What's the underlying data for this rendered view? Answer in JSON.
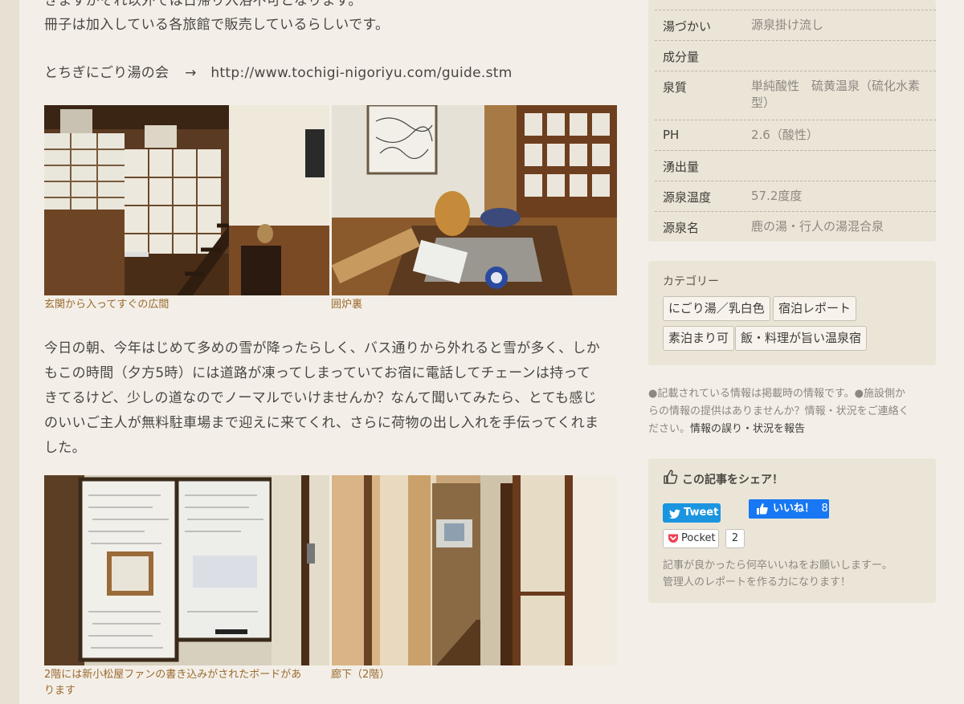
{
  "article": {
    "line_cut": "きますがそれ以外では日帰り入浴不可となります。",
    "line_booklet": "冊子は加入している各旅館で販売しているらしいです。",
    "link_label": "とちぎにごり湯の会",
    "arrow": "→",
    "link_url": "http://www.tochigi-nigoriyu.com/guide.stm",
    "photos_row1": [
      {
        "icon": "entrance-staircase-photo",
        "caption": "玄関から入ってすぐの広間"
      },
      {
        "icon": "irori-hearth-photo",
        "caption": "囲炉裏"
      }
    ],
    "paragraph": [
      "今日の朝、今年はじめて多めの雪が降ったらしく、バス通りから外れると雪が多く、しか",
      "もこの時間（夕方5時）には道路が凍ってしまっていてお宿に電話してチェーンは持って",
      "きてるけど、少しの道なのでノーマルでいけませんか？なんて聞いてみたら、とても感じ",
      "のいいご主人が無料駐車場まで迎えに来てくれ、さらに荷物の出し入れを手伝ってくれま",
      "した。"
    ],
    "photos_row2": [
      {
        "icon": "message-board-photo",
        "caption_lines": [
          "2階には新小松屋ファンの書き込みがされたボードがあ",
          "ります"
        ]
      },
      {
        "icon": "hallway-photo",
        "caption_lines": [
          "廊下（2階）"
        ]
      }
    ]
  },
  "spring_info": {
    "rows": [
      {
        "key": "湯づかい",
        "value": "源泉掛け流し"
      },
      {
        "key": "成分量",
        "value": ""
      },
      {
        "key": "泉質",
        "value": "単純酸性　硫黄温泉（硫化水素型）"
      },
      {
        "key": "PH",
        "value": "2.6（酸性）"
      },
      {
        "key": "湧出量",
        "value": ""
      },
      {
        "key": "源泉温度",
        "value": "57.2度度"
      },
      {
        "key": "源泉名",
        "value": "鹿の湯・行人の湯混合泉"
      }
    ]
  },
  "categories": {
    "title": "カテゴリー",
    "tags": [
      "にごり湯／乳白色",
      "宿泊レポート",
      "素泊まり可",
      "飯・料理が旨い温泉宿"
    ]
  },
  "notice": {
    "text_lines": [
      "●記載されている情報は掲載時の情報です。●施設側か",
      "らの情報の提供はありませんか？情報・状況をご連絡く",
      "ださい。"
    ],
    "report_link": "情報の誤り・状況を報告"
  },
  "share": {
    "title": "この記事をシェア！",
    "tweet_label": "Tweet",
    "like_label": "いいね！",
    "like_count": "8",
    "pocket_label": "Pocket",
    "pocket_count": "2",
    "note_lines": [
      "記事が良かったら何卒いいねをお願いしますー。",
      "管理人のレポートを作る力になります！"
    ]
  },
  "colors": {
    "caption": "#9b6a2f",
    "twitter": "#1b95e0",
    "facebook": "#1877f2",
    "pocket": "#ef4056"
  }
}
